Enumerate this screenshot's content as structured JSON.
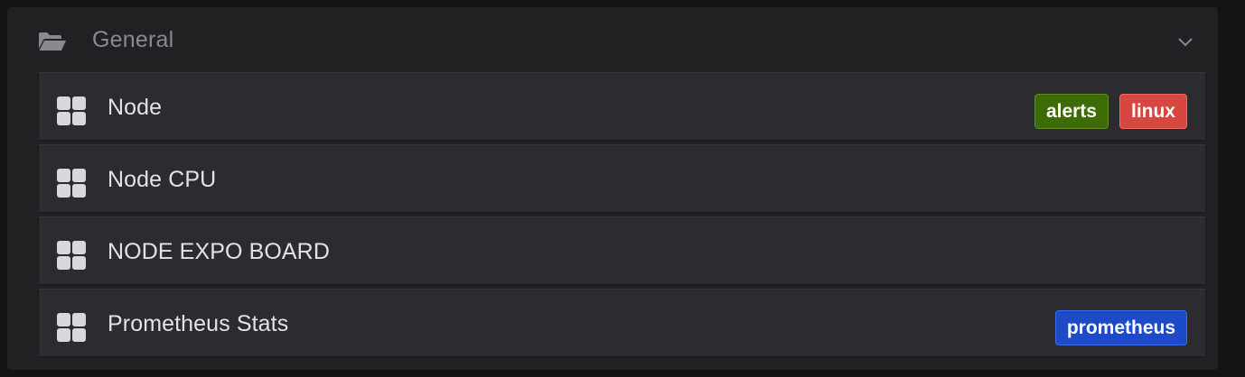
{
  "section": {
    "title": "General",
    "folder_icon": "folder-open-icon",
    "toggle_icon": "chevron-down-icon"
  },
  "dashboards": [
    {
      "title": "Node",
      "icon": "dashboard-grid-icon",
      "tags": [
        {
          "label": "alerts",
          "background": "#3d6b06",
          "border": "#5a8e1e"
        },
        {
          "label": "linux",
          "background": "#d7473f",
          "border": "#f06a61"
        }
      ]
    },
    {
      "title": "Node CPU",
      "icon": "dashboard-grid-icon",
      "tags": []
    },
    {
      "title": "NODE EXPO BOARD",
      "icon": "dashboard-grid-icon",
      "tags": []
    },
    {
      "title": "Prometheus Stats",
      "icon": "dashboard-grid-icon",
      "tags": [
        {
          "label": "prometheus",
          "background": "#1d4bc7",
          "border": "#3b6cf0"
        }
      ]
    }
  ],
  "colors": {
    "page_background": "#141416",
    "panel_background": "#212124",
    "row_background": "#2c2c30",
    "title_text": "#e3e3e6",
    "section_text": "#8a8a8e"
  }
}
